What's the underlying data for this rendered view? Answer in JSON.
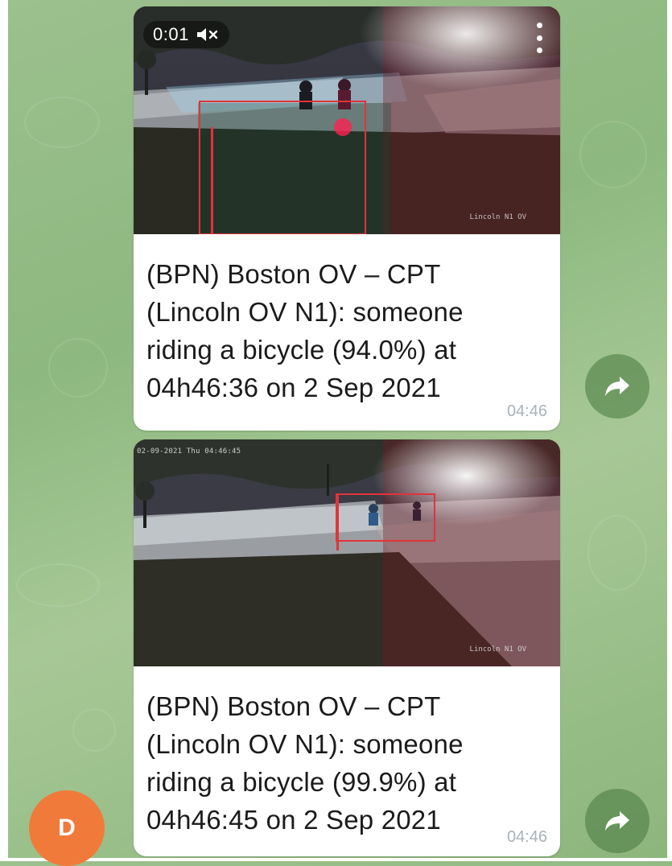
{
  "chat": {
    "messages": [
      {
        "video": {
          "duration": "0:01",
          "muted": true
        },
        "camera_overlay": {
          "top_text": "",
          "bottom_text": "Lincoln N1 OV"
        },
        "caption_lines": [
          "(BPN) Boston OV – CPT",
          "(Lincoln OV N1): someone",
          "riding a bicycle (94.0%) at",
          "04h46:36 on 2 Sep 2021"
        ],
        "time": "04:46"
      },
      {
        "camera_overlay": {
          "top_text": "02-09-2021 Thu 04:46:45",
          "bottom_text": "Lincoln N1 OV"
        },
        "caption_lines": [
          "(BPN) Boston OV – CPT",
          "(Lincoln OV N1): someone",
          "riding a bicycle (99.9%) at",
          "04h46:45 on 2 Sep 2021"
        ],
        "time": "04:46"
      }
    ],
    "sender_avatar": {
      "initial": "D",
      "color": "#f07a3a"
    },
    "icons": {
      "share": "share-arrow-icon",
      "mute": "speaker-muted-icon",
      "menu": "kebab-menu-icon"
    },
    "colors": {
      "wallpaper": "#9cc08e",
      "bubble": "#ffffff",
      "timestamp": "#a9b3b8",
      "detection_box": "#e0343a"
    }
  }
}
